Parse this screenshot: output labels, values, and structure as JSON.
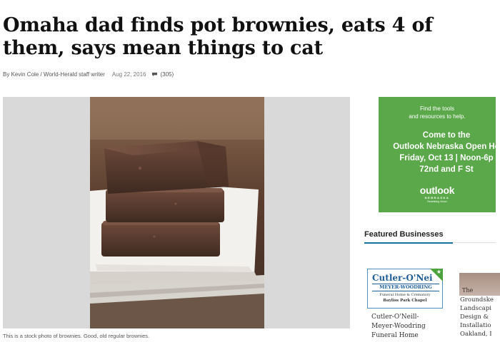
{
  "article": {
    "headline": "Omaha dad finds pot brownies, eats 4 of them, says mean things to cat",
    "byline": "By Kevin Cole / World-Herald staff writer",
    "date": "Aug 22, 2016",
    "comments": "(305)",
    "caption": "This is a stock photo of brownies. Good, old regular brownies."
  },
  "ad": {
    "small_line1": "Find the tools",
    "small_line2": "and resources to help.",
    "big_line1": "Come to the",
    "big_line2": "Outlook Nebraska Open Ho",
    "big_line3": "Friday, Oct 13 | Noon-6p",
    "big_line4": "72nd and F St",
    "logo": "outlook",
    "logo_sub": "NEBRASKA",
    "logo_tag": "Redefining Vision",
    "bg_color": "#5aa84a"
  },
  "featured": {
    "title": "Featured Businesses",
    "accent_color": "#1a6fa8",
    "businesses": [
      {
        "logo_name": "Cutler-O'Nei",
        "logo_sub": "MEYER-WOODRING",
        "logo_line1": "Funeral Home & Crematory",
        "logo_line2": "Bayliss Park Chapel",
        "name_line1": "Cutler-O'Neill-",
        "name_line2": "Meyer-Woodring",
        "name_line3": "Funeral Home"
      },
      {
        "logo_name": "The",
        "name_line1": "Groundske",
        "name_line2": "Landscapi",
        "name_line3": "Design &",
        "name_line4": "Installatio",
        "name_line5": "Oakland, I"
      }
    ]
  }
}
